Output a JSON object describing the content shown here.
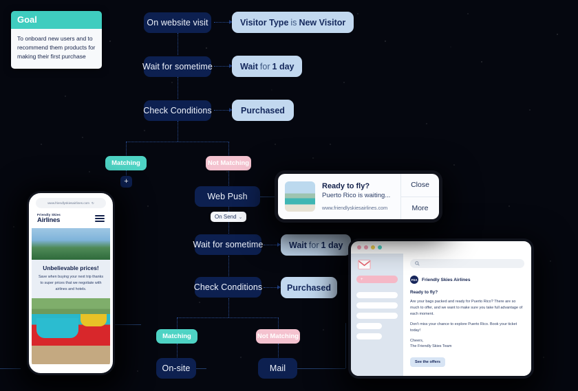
{
  "goal": {
    "title": "Goal",
    "body": "To onboard new users and to recommend them products for making their first purchase"
  },
  "flow": {
    "nodes": [
      {
        "label": "On website visit"
      },
      {
        "label": "Wait for sometime"
      },
      {
        "label": "Check Conditions"
      },
      {
        "label": "Web Push"
      },
      {
        "label": "Wait for sometime"
      },
      {
        "label": "Check Conditions"
      },
      {
        "label": "On-site"
      },
      {
        "label": "Mail"
      }
    ],
    "chips": [
      {
        "bold1": "Visitor Type",
        "reg": "is",
        "bold2": "New Visitor"
      },
      {
        "bold1": "Wait",
        "reg": "for",
        "bold2": "1 day"
      },
      {
        "bold1": "Purchased",
        "reg": "",
        "bold2": ""
      },
      {
        "bold1": "Wait",
        "reg": "for",
        "bold2": "1 day"
      },
      {
        "bold1": "Purchased",
        "reg": "",
        "bold2": ""
      }
    ],
    "branch_labels": {
      "matching": "Matching",
      "not_matching": "Not Matching"
    },
    "add_button": "+",
    "trigger_select": {
      "value": "On Send",
      "chevron": "⌄"
    }
  },
  "phone": {
    "url": "www.friendlyskiesairlines.com",
    "reload_icon": "↻",
    "brand_line1": "Friendly Skies",
    "brand_line2": "Airlines",
    "promo_title": "Unbelievable prices!",
    "promo_text": "Save when buying your next trip thanks to super prices that we negotiate with airlines and hotels."
  },
  "push": {
    "title": "Ready to fly?",
    "subtitle": "Puerto Rico is waiting...",
    "url": "www.friendlyskiesairlines.com",
    "close_label": "Close",
    "more_label": "More"
  },
  "email": {
    "window_dots": [
      "#f4a0b5",
      "#f4c9a0",
      "#f2d14f",
      "#4ed3c4"
    ],
    "compose_label": "+",
    "search_placeholder": "",
    "sender_initials": "FSA",
    "sender_name": "Friendly Skies Airlines",
    "subject": "Ready to fly?",
    "paragraph1": "Are your bags packed and ready for Puerto Rico? There are so much to offer, and we want to make sure you take full advantage of each moment.",
    "paragraph2": "Don't miss your chance to explore Puerto Rico. Book your ticket today!",
    "signoff1": "Cheers,",
    "signoff2": "The Friendly Skies Team",
    "cta_label": "See the offers"
  },
  "colors": {
    "background": "#05070f",
    "node": "#0d2050",
    "chip": "#c2d8ef",
    "matching": "#4ed3c4",
    "not_matching": "#f4c2cf",
    "goal_header": "#3fcdbf",
    "connector": "#2b4f96"
  }
}
